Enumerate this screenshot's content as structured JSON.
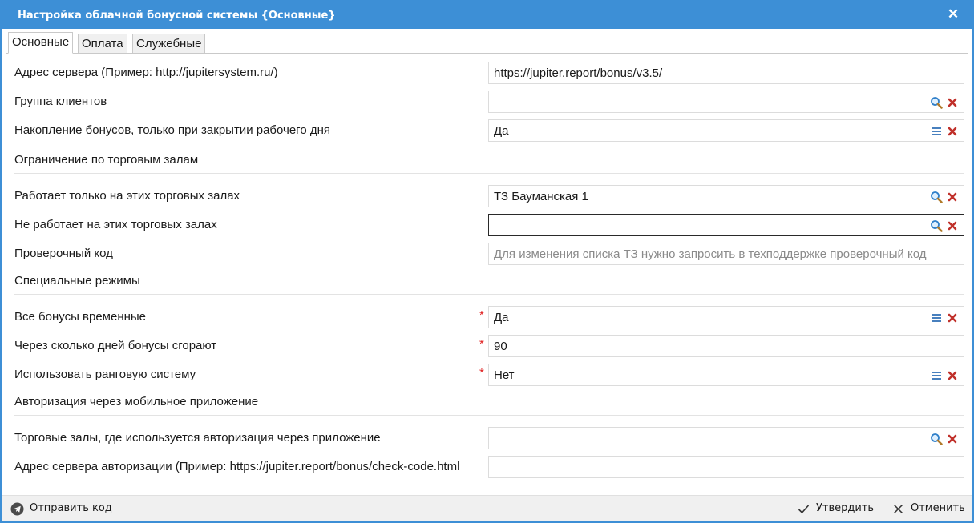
{
  "window": {
    "title": "Настройка облачной бонусной системы {Основные}"
  },
  "tabs": [
    {
      "label": "Основные"
    },
    {
      "label": "Оплата"
    },
    {
      "label": "Служебные"
    }
  ],
  "rows": {
    "server": {
      "label": "Адрес сервера (Пример: http://jupitersystem.ru/)",
      "value": "https://jupiter.report/bonus/v3.5/"
    },
    "client_group": {
      "label": "Группа клиентов",
      "value": ""
    },
    "accumulation": {
      "label": "Накопление бонусов, только при закрытии рабочего дня",
      "value": "Да"
    },
    "works_only": {
      "label": "Работает только на этих торговых залах",
      "value": "ТЗ Бауманская 1"
    },
    "not_works": {
      "label": "Не работает на этих торговых залах",
      "value": ""
    },
    "check_code": {
      "label": "Проверочный код",
      "placeholder": "Для изменения списка ТЗ нужно запросить в техподдержке проверочный код"
    },
    "temporary": {
      "label": "Все бонусы временные",
      "value": "Да"
    },
    "burn_days": {
      "label": "Через сколько дней бонусы сгорают",
      "value": "90"
    },
    "rank": {
      "label": "Использовать ранговую систему",
      "value": "Нет"
    },
    "auth_halls": {
      "label": "Торговые залы, где используется авторизация через приложение",
      "value": ""
    },
    "auth_server": {
      "label": "Адрес сервера авторизации (Пример: https://jupiter.report/bonus/check-code.html",
      "value": ""
    }
  },
  "sections": {
    "halls": "Ограничение по торговым залам",
    "special": "Специальные режимы",
    "mobile": "Авторизация через мобильное приложение"
  },
  "required_mark": "*",
  "footer": {
    "send_code": "Отправить код",
    "confirm": "Утвердить",
    "cancel": "Отменить"
  },
  "colors": {
    "accent": "#3d8fd6",
    "required": "#e02020",
    "clear_icon": "#c0302a",
    "search_icon": "#2f7fc9"
  },
  "icons": {
    "close": "close-icon",
    "search": "search-icon",
    "clear": "clear-icon",
    "list": "list-icon",
    "telegram": "telegram-icon",
    "check": "check-icon",
    "cancel": "cancel-icon"
  }
}
